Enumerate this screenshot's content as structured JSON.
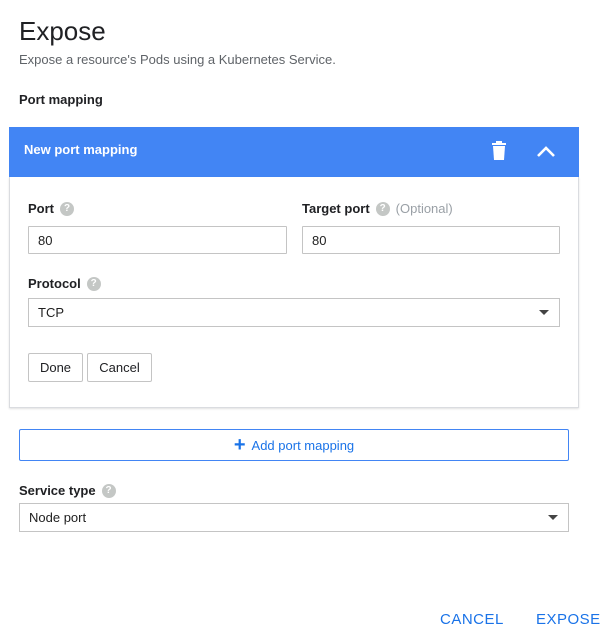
{
  "dialog": {
    "title": "Expose",
    "subtitle": "Expose a resource's Pods using a Kubernetes Service.",
    "port_mapping_label": "Port mapping"
  },
  "panel": {
    "title": "New port mapping",
    "header_color": "#4285f4",
    "port": {
      "label": "Port",
      "value": "80"
    },
    "target_port": {
      "label": "Target port",
      "optional": "(Optional)",
      "value": "80"
    },
    "protocol": {
      "label": "Protocol",
      "value": "TCP"
    },
    "done_label": "Done",
    "cancel_label": "Cancel"
  },
  "add_port_mapping": {
    "icon": "plus-icon",
    "label": "Add port mapping"
  },
  "service_type": {
    "label": "Service type",
    "value": "Node port"
  },
  "footer": {
    "cancel_label": "CANCEL",
    "expose_label": "EXPOSE",
    "accent": "#1a73e8"
  }
}
